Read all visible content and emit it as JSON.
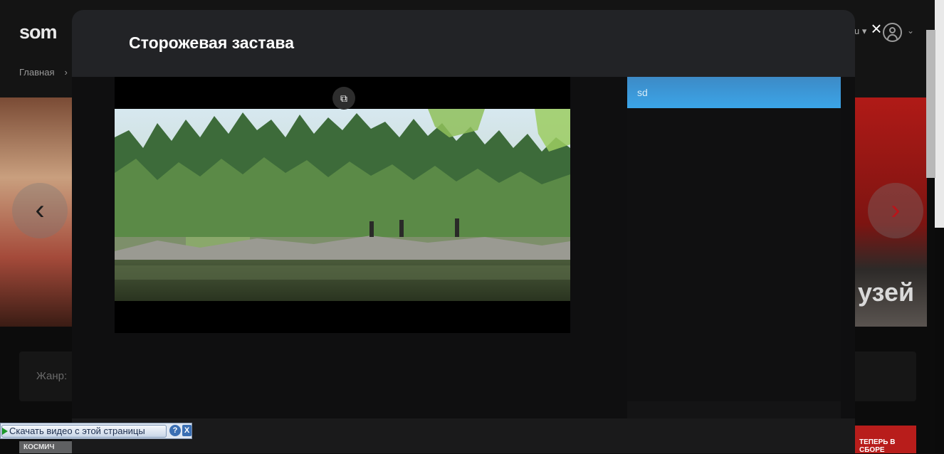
{
  "background": {
    "logo_text": "som",
    "breadcrumb_home": "Главная",
    "breadcrumb_sep": "›",
    "lang_label": "u",
    "genre_label": "Жанр:",
    "banner_right_text": "узей",
    "poster_bottom_right_text": "ТЕПЕРЬ В СБОРЕ",
    "poster_bottom_left_text": "КОСМИЧ"
  },
  "modal": {
    "title": "Сторожевая застава",
    "close_glyph": "×",
    "pip_glyph": "⧉"
  },
  "quality": {
    "items": [
      {
        "label": "sd",
        "selected": true
      }
    ]
  },
  "download_bar": {
    "button_label": "Скачать видео с этой страницы",
    "help_label": "?",
    "close_label": "X"
  },
  "colors": {
    "accent_blue": "#3ba5e8",
    "brand_red": "#e4262f"
  },
  "icons": {
    "prev": "chevron-left-icon",
    "next": "chevron-right-icon",
    "close": "close-icon",
    "pip": "picture-in-picture-icon",
    "user": "user-icon"
  }
}
